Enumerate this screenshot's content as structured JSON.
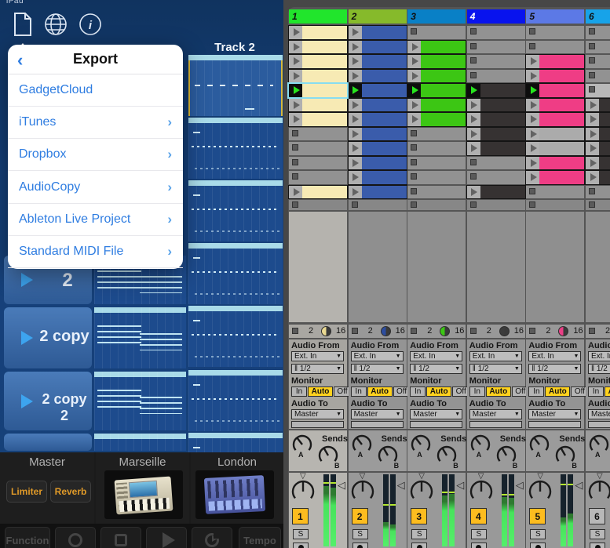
{
  "left_app": {
    "status_text": "iPad",
    "toolbar_icons": [
      "document-icon",
      "globe-icon",
      "info-icon"
    ],
    "track_header": "Track 2",
    "popover": {
      "back_label": "‹",
      "title": "Export",
      "items": [
        {
          "label": "GadgetCloud",
          "chevron": false
        },
        {
          "label": "iTunes",
          "chevron": true
        },
        {
          "label": "Dropbox",
          "chevron": true
        },
        {
          "label": "AudioCopy",
          "chevron": true
        },
        {
          "label": "Ableton Live Project",
          "chevron": true
        },
        {
          "label": "Standard MIDI File",
          "chevron": true
        }
      ]
    },
    "scenes": [
      {
        "label": "2"
      },
      {
        "label": "2 copy"
      },
      {
        "label": "2 copy 2"
      },
      {
        "label": ""
      }
    ],
    "device_sections": [
      {
        "title": "Master",
        "buttons": [
          "Limiter",
          "Reverb"
        ]
      },
      {
        "title": "Marseille",
        "buttons": []
      },
      {
        "title": "London",
        "buttons": []
      }
    ],
    "transport": [
      {
        "name": "function-button",
        "label": "Function"
      },
      {
        "name": "record-button",
        "icon": "record-icon"
      },
      {
        "name": "stop-button",
        "icon": "stop-icon"
      },
      {
        "name": "play-button",
        "icon": "play-icon"
      },
      {
        "name": "loop-button",
        "icon": "loop-icon"
      },
      {
        "name": "tempo-button",
        "label": "Tempo"
      }
    ]
  },
  "ableton": {
    "track_headers": [
      {
        "number": "1",
        "color": "#21e52c",
        "text": "#101010"
      },
      {
        "number": "2",
        "color": "#86ba2b",
        "text": "#101010"
      },
      {
        "number": "3",
        "color": "#0980c6",
        "text": "#101010"
      },
      {
        "number": "4",
        "color": "#0813ee",
        "text": "#ffffff"
      },
      {
        "number": "5",
        "color": "#5c79e6",
        "text": "#101010"
      },
      {
        "number": "6",
        "color": "#17a3e9",
        "text": "#101010"
      }
    ],
    "clip_colors": {
      "Y": "#f7eab4",
      "B": "#3a5cab",
      "G": "#3cc614",
      "D": "#363232",
      "P": "#ef3d85",
      "X": "#ababab"
    },
    "grid": {
      "playing_row": 5,
      "selected_clip": {
        "track": 1,
        "row": 5
      },
      "highlight_slot": {
        "track": 6,
        "row": 5
      },
      "rows": [
        [
          "Y",
          "B",
          "-",
          "-",
          "-",
          "-"
        ],
        [
          "Y",
          "B",
          "G",
          "-",
          "-",
          "-"
        ],
        [
          "Y",
          "B",
          "G",
          "-",
          "P",
          "-"
        ],
        [
          "Y",
          "B",
          "G",
          "-",
          "P",
          "-"
        ],
        [
          "Y",
          "B",
          "G",
          "D",
          "P",
          "-"
        ],
        [
          "Y",
          "B",
          "G",
          "D",
          "P",
          "D"
        ],
        [
          "Y",
          "B",
          "G",
          "D",
          "P",
          "D"
        ],
        [
          "-",
          "B",
          "-",
          "D",
          "X",
          "D"
        ],
        [
          "-",
          "B",
          "-",
          "D",
          "X",
          "D"
        ],
        [
          "-",
          "B",
          "-",
          "-",
          "P",
          "D"
        ],
        [
          "-",
          "B",
          "-",
          "-",
          "P",
          "D"
        ],
        [
          "Y",
          "B",
          "-",
          "D",
          "-",
          "-"
        ]
      ]
    },
    "status_row": {
      "count": "2",
      "length": "16",
      "pie_colors": [
        "#ead992",
        "#2c4da0",
        "#3cc614",
        "#3c3c3c",
        "#ea3f86",
        "#3c3c3c"
      ]
    },
    "io": {
      "audio_from": "Audio From",
      "input": "Ext. In",
      "channel": "‖ 1/2",
      "monitor": "Monitor",
      "monitor_buttons": [
        "In",
        "Auto",
        "Off"
      ],
      "monitor_active": "Auto",
      "audio_to": "Audio To",
      "output": "Master"
    },
    "sends": {
      "label": "Sends",
      "knobs": [
        "A",
        "B"
      ]
    },
    "mixer": {
      "solo_label": "S",
      "tracks": [
        {
          "number": "1",
          "active": true,
          "fills": [
            0.84,
            0.82
          ],
          "peak": 0.87
        },
        {
          "number": "2",
          "active": true,
          "fills": [
            0.34,
            0.3
          ],
          "peak": 0.56
        },
        {
          "number": "3",
          "active": true,
          "fills": [
            0.71,
            0.73
          ],
          "peak": 0.74
        },
        {
          "number": "4",
          "active": true,
          "fills": [
            0.69,
            0.67
          ],
          "peak": 0.71
        },
        {
          "number": "5",
          "active": true,
          "fills": [
            0.4,
            0.46
          ],
          "peak": 0.85
        },
        {
          "number": "6",
          "active": false,
          "fills": [
            0.5,
            0.5
          ],
          "peak": 0.6
        }
      ]
    }
  }
}
